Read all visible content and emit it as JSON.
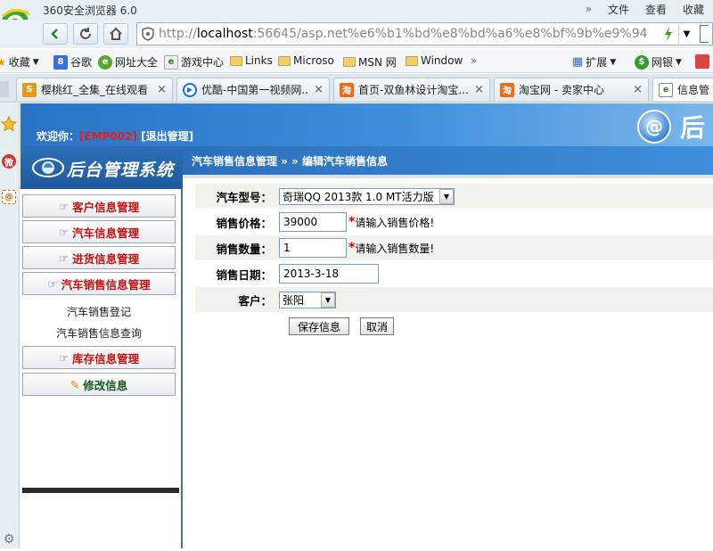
{
  "browser": {
    "title": "360安全浏览器 6.0",
    "menu": {
      "more": "»",
      "file": "文件",
      "view": "查看",
      "favorites": "收藏"
    },
    "url_prefix": "http://",
    "url_host": "localhost",
    "url_rest": ":56645/asp.net%e6%b1%bd%e8%bd%a6%e8%bf%9b%e9%94",
    "favbar": [
      {
        "label": "收藏"
      },
      {
        "label": "谷歌"
      },
      {
        "label": "网址大全"
      },
      {
        "label": "游戏中心"
      },
      {
        "label": "Links"
      },
      {
        "label": "Microso"
      },
      {
        "label": "MSN 网"
      },
      {
        "label": "Window"
      },
      {
        "label": "»"
      },
      {
        "label": "扩展"
      },
      {
        "label": "网银"
      }
    ],
    "tabs": [
      {
        "label": "樱桃红_全集_在线观看 ..."
      },
      {
        "label": "优酷-中国第一视频网..."
      },
      {
        "label": "首页-双鱼林设计淘宝..."
      },
      {
        "label": "淘宝网 - 卖家中心"
      },
      {
        "label": "信息管理"
      }
    ],
    "tab_close": "×"
  },
  "page": {
    "welcome_prefix": "欢迎你：",
    "user": "[EMP002]",
    "logout": "[退出管理]",
    "brand_right": "后",
    "system_title": "后台管理系统",
    "breadcrumb": "汽车销售信息管理 » » 编辑汽车销售信息",
    "nav": {
      "customer": "客户信息管理",
      "car": "汽车信息管理",
      "purchase": "进货信息管理",
      "sales": "汽车销售信息管理",
      "sales_register": "汽车销售登记",
      "sales_query": "汽车销售信息查询",
      "inventory": "库存信息管理",
      "edit_info": "修改信息"
    },
    "form": {
      "model_label": "汽车型号：",
      "model_value": "奇瑞QQ 2013款 1.0 MT活力版",
      "price_label": "销售价格：",
      "price_value": "39000",
      "price_hint": "请输入销售价格!",
      "qty_label": "销售数量：",
      "qty_value": "1",
      "qty_hint": "请输入销售数量!",
      "date_label": "销售日期：",
      "date_value": "2013-3-18",
      "customer_label": "客户：",
      "customer_value": "张阳",
      "required_mark": "*",
      "save": "保存信息",
      "cancel": "取消"
    }
  }
}
